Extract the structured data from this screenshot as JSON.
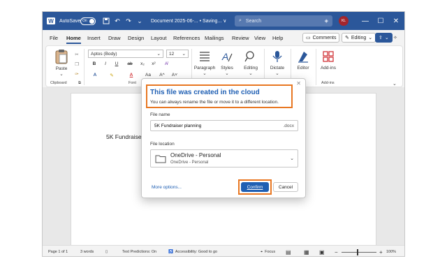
{
  "titlebar": {
    "autosave_label": "AutoSave",
    "autosave_state": "On",
    "document_title": "Document 2025-06-... • Saving... ∨",
    "search_placeholder": "Search",
    "avatar_initials": "KL"
  },
  "menu": {
    "tabs": [
      "File",
      "Home",
      "Insert",
      "Draw",
      "Design",
      "Layout",
      "References",
      "Mailings",
      "Review",
      "View",
      "Help"
    ],
    "active_tab": "Home",
    "comments_label": "Comments",
    "editing_label": "Editing"
  },
  "ribbon": {
    "paste_label": "Paste",
    "clipboard_group": "Clipboard",
    "font_name": "Aptos (Body)",
    "font_size": "12",
    "font_group": "Font",
    "paragraph_label": "Paragraph",
    "styles_label": "Styles",
    "editing_label": "Editing",
    "dictate_label": "Dictate",
    "editor_label": "Editor",
    "addins_label": "Add-ins",
    "addins_group": "Add-ins",
    "bold": "B",
    "italic": "I",
    "underline": "U",
    "strike": "ab",
    "subscript": "x₂",
    "superscript": "x²",
    "case": "Aa",
    "grow": "A^",
    "shrink": "A˅"
  },
  "document": {
    "body_text": "5K Fundraiser"
  },
  "dialog": {
    "title": "This file was created in the cloud",
    "subtitle": "You can always rename the file or move it to a different location.",
    "filename_label": "File name",
    "filename_value": "5K Fundraiser planning",
    "extension": ".docx",
    "location_label": "File location",
    "location_name": "OneDrive - Personal",
    "location_sub": "OneDrive - Personal",
    "more_options": "More options...",
    "confirm": "Confirm",
    "cancel": "Cancel"
  },
  "statusbar": {
    "page": "Page 1 of 1",
    "words": "3 words",
    "text_predictions": "Text Predictions: On",
    "accessibility": "Accessibility: Good to go",
    "focus": "Focus",
    "zoom": "100%"
  },
  "colors": {
    "titlebar": "#2b579a",
    "accent": "#1f5fb3",
    "highlight": "#e87722"
  }
}
